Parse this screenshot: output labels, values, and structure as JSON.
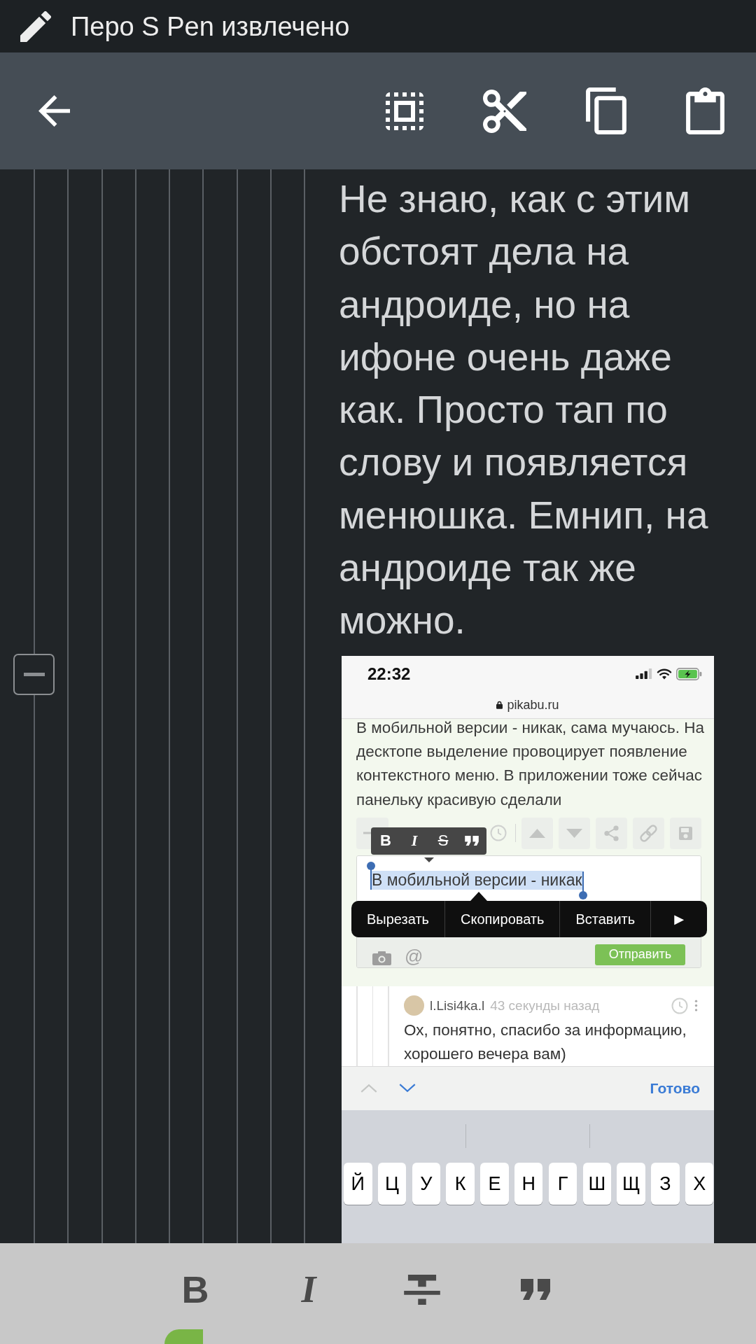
{
  "status_bar": {
    "notification": "Перо S Pen извлечено"
  },
  "comment": {
    "expanded": true,
    "text": "Не знаю, как с этим обстоят дела на андроиде, но на ифоне очень даже как. Просто тап по слову и появляется менюшка. Емнип, на андроиде так же можно.",
    "attachment": {
      "time": "22:32",
      "url": "pikabu.ru",
      "post_text": "В мобильной версии - никак, сама мучаюсь. На десктопе выделение провоцирует появление контекстного меню. В приложении тоже сейчас панельку красивую сделали",
      "format_popup": [
        {
          "kind": "bold",
          "label": "B"
        },
        {
          "kind": "italic",
          "label": "I"
        },
        {
          "kind": "strike",
          "label": "S"
        },
        {
          "kind": "quote"
        }
      ],
      "editor": {
        "selected_text": "В мобильной версии - никак",
        "mention": "@",
        "submit": "Отправить"
      },
      "edit_menu": {
        "items": [
          "Вырезать",
          "Скопировать",
          "Вставить"
        ],
        "more": "▶"
      },
      "reply": {
        "author": "l.Lisi4ka.l",
        "time": "43 секунды назад",
        "text": "Ох, понятно, спасибо за информацию, хорошего вечера вам)"
      },
      "keyboard": {
        "nav": [
          {
            "kind": "up",
            "disabled": true
          },
          {
            "kind": "down",
            "disabled": false
          }
        ],
        "done": "Готово",
        "keys": [
          "Й",
          "Ц",
          "У",
          "К",
          "Е",
          "Н",
          "Г",
          "Ш",
          "Щ",
          "З",
          "Х"
        ]
      }
    }
  },
  "format_bar": [
    {
      "kind": "bold",
      "label": "B"
    },
    {
      "kind": "italic",
      "label": "I"
    },
    {
      "kind": "strike"
    },
    {
      "kind": "quote"
    }
  ]
}
